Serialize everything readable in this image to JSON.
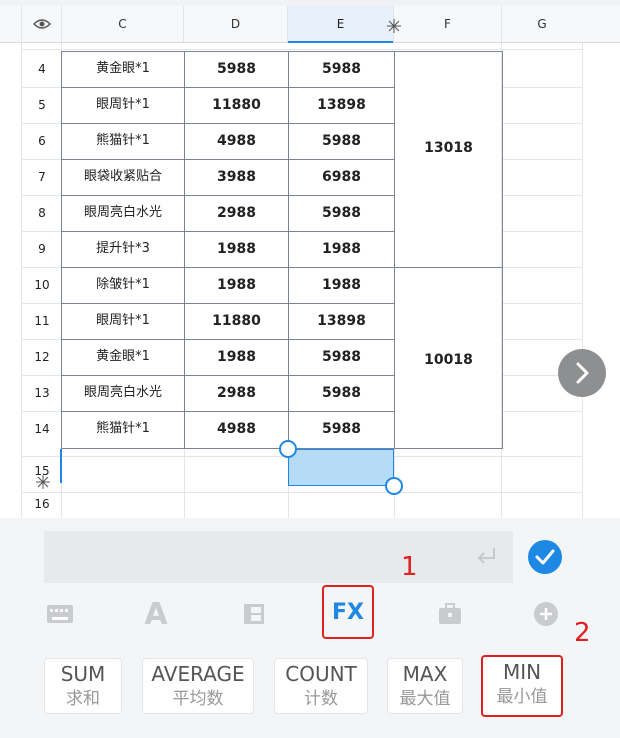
{
  "columns": {
    "eye": "eye-icon",
    "C": "C",
    "D": "D",
    "E": "E",
    "F": "F",
    "G": "G"
  },
  "rows": [
    {
      "num": "4",
      "c": "黄金眼*1",
      "d": "5988",
      "e": "5988"
    },
    {
      "num": "5",
      "c": "眼周针*1",
      "d": "11880",
      "e": "13898"
    },
    {
      "num": "6",
      "c": "熊猫针*1",
      "d": "4988",
      "e": "5988"
    },
    {
      "num": "7",
      "c": "眼袋收紧贴合",
      "d": "3988",
      "e": "6988"
    },
    {
      "num": "8",
      "c": "眼周亮白水光",
      "d": "2988",
      "e": "5988"
    },
    {
      "num": "9",
      "c": "提升针*3",
      "d": "1988",
      "e": "1988"
    },
    {
      "num": "10",
      "c": "除皱针*1",
      "d": "1988",
      "e": "1988"
    },
    {
      "num": "11",
      "c": "眼周针*1",
      "d": "11880",
      "e": "13898"
    },
    {
      "num": "12",
      "c": "黄金眼*1",
      "d": "1988",
      "e": "5988"
    },
    {
      "num": "13",
      "c": "眼周亮白水光",
      "d": "2988",
      "e": "5988"
    },
    {
      "num": "14",
      "c": "熊猫针*1",
      "d": "4988",
      "e": "5988"
    },
    {
      "num": "15",
      "c": "",
      "d": "",
      "e": ""
    },
    {
      "num": "16",
      "c": "",
      "d": "",
      "e": ""
    }
  ],
  "merged": {
    "f_group1": "13018",
    "f_group2": "10018"
  },
  "toolbar": {
    "fx": "FX",
    "icons": [
      "keyboard-icon",
      "font-icon",
      "layout-icon",
      "fx-icon",
      "toolbox-icon",
      "add-icon"
    ]
  },
  "functions": [
    {
      "en": "SUM",
      "zh": "求和"
    },
    {
      "en": "AVERAGE",
      "zh": "平均数"
    },
    {
      "en": "COUNT",
      "zh": "计数"
    },
    {
      "en": "MAX",
      "zh": "最大值"
    },
    {
      "en": "MIN",
      "zh": "最小值"
    }
  ],
  "annotations": {
    "a1": "1",
    "a2": "2"
  },
  "colors": {
    "accent": "#1e88e5",
    "annotation": "#e02020"
  }
}
